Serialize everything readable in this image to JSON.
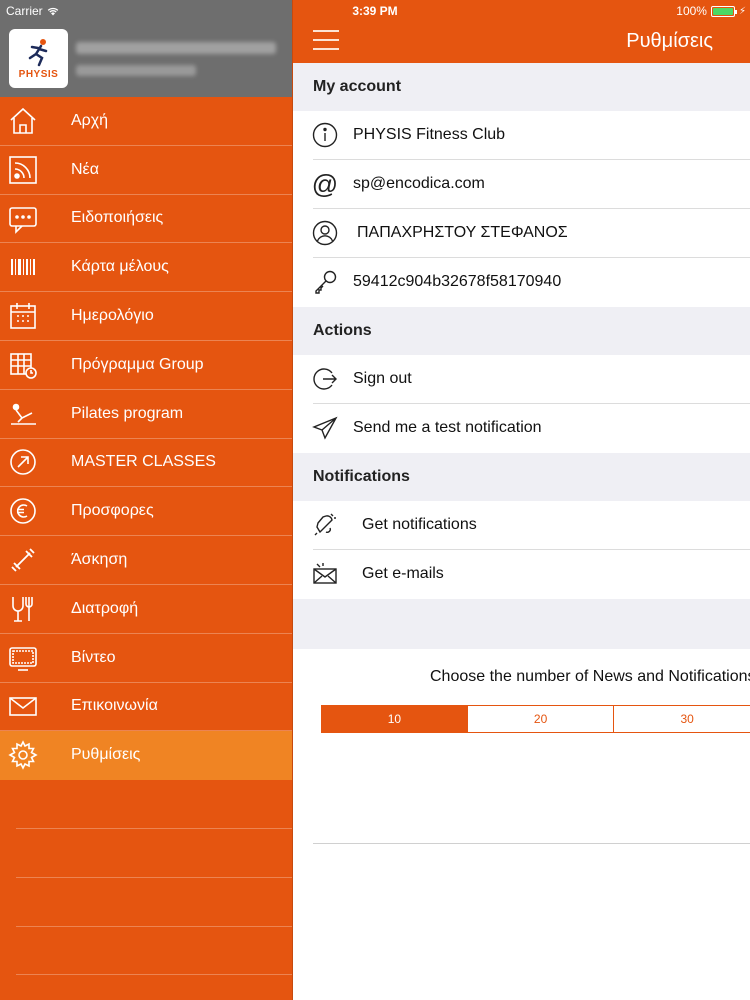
{
  "status": {
    "carrier": "Carrier",
    "time": "3:39 PM",
    "battery": "100%"
  },
  "profile": {
    "brand": "PHYSIS"
  },
  "menu": [
    {
      "label": "Αρχή",
      "icon": "home-icon"
    },
    {
      "label": "Νέα",
      "icon": "rss-icon"
    },
    {
      "label": "Ειδοποιήσεις",
      "icon": "chat-icon"
    },
    {
      "label": "Κάρτα μέλους",
      "icon": "barcode-icon"
    },
    {
      "label": "Ημερολόγιο",
      "icon": "calendar-icon"
    },
    {
      "label": "Πρόγραμμα Group",
      "icon": "schedule-icon"
    },
    {
      "label": "Pilates program",
      "icon": "pilates-icon"
    },
    {
      "label": "MASTER CLASSES",
      "icon": "arrow-circle-icon"
    },
    {
      "label": "Προσφορες",
      "icon": "euro-icon"
    },
    {
      "label": "Άσκηση",
      "icon": "dumbbell-icon"
    },
    {
      "label": "Διατροφή",
      "icon": "cutlery-icon"
    },
    {
      "label": "Βίντεο",
      "icon": "tv-icon"
    },
    {
      "label": "Επικοινωνία",
      "icon": "mail-icon"
    },
    {
      "label": "Ρυθμίσεις",
      "icon": "gear-icon",
      "active": true
    }
  ],
  "nav": {
    "title": "Ρυθμίσεις"
  },
  "sections": {
    "account": {
      "header": "My account",
      "club": "PHYSIS Fitness Club",
      "email": "sp@encodica.com",
      "name": "ΠΑΠΑΧΡΗΣΤΟΥ ΣΤΕΦΑΝΟΣ",
      "key": "59412c904b32678f58170940"
    },
    "actions": {
      "header": "Actions",
      "sign_out": "Sign out",
      "test_notification": "Send me a test notification"
    },
    "notifications": {
      "header": "Notifications",
      "get_notifications": "Get notifications",
      "get_emails": "Get e-mails"
    }
  },
  "news_count": {
    "prompt": "Choose the number of News and Notifications",
    "options": [
      "10",
      "20",
      "30"
    ],
    "selected": "10"
  },
  "colors": {
    "accent": "#e55510",
    "active": "#f08423",
    "profile_bg": "#6e6e6e",
    "group_bg": "#efeff4"
  }
}
